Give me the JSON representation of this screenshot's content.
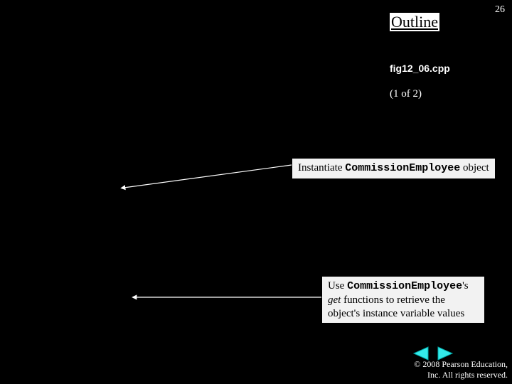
{
  "header": {
    "outline_label": "Outline",
    "page_number": "26",
    "filename": "fig12_06.cpp",
    "page_of": "(1 of 2)"
  },
  "callouts": {
    "c1_pre": "Instantiate ",
    "c1_mono": "CommissionEmployee",
    "c1_post": " object",
    "c2_pre": "Use ",
    "c2_mono": "CommissionEmployee",
    "c2_mid": "'s ",
    "c2_ital": "get",
    "c2_post": " functions to retrieve the object's instance variable values"
  },
  "footer": {
    "line1": "© 2008 Pearson Education,",
    "line2": "Inc.  All rights reserved."
  },
  "nav": {
    "prev": "previous",
    "next": "next"
  }
}
